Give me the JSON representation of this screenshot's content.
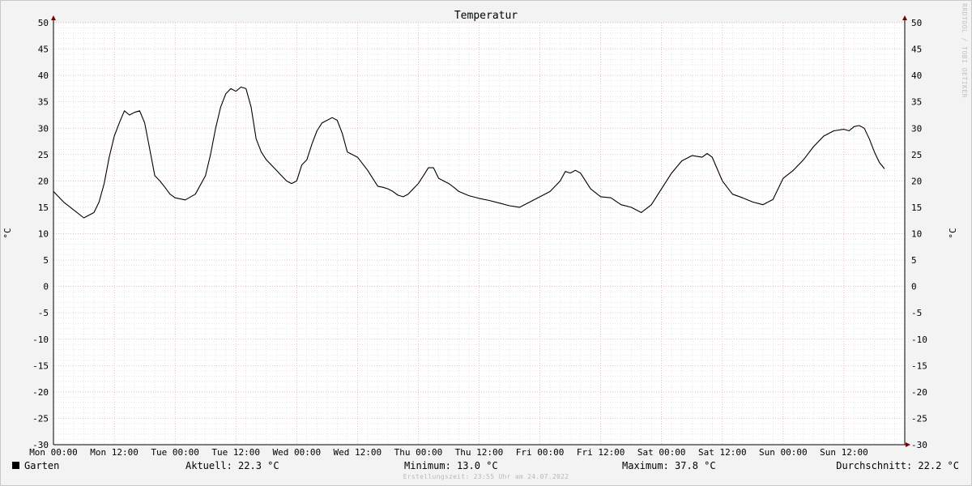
{
  "chart_data": {
    "type": "line",
    "title": "Temperatur",
    "ylabel": "°C",
    "ylim": [
      -30,
      50
    ],
    "ytick_values": [
      50,
      45,
      40,
      35,
      30,
      25,
      20,
      15,
      10,
      5,
      0,
      -5,
      -10,
      -15,
      -20,
      -25,
      -30
    ],
    "y_ticks": [
      "50",
      "45",
      "40",
      "35",
      "30",
      "25",
      "20",
      "15",
      "10",
      "5",
      "0",
      "-5",
      "-10",
      "-15",
      "-20",
      "-25",
      "-30"
    ],
    "x_ticks": [
      "Mon 00:00",
      "Mon 12:00",
      "Tue 00:00",
      "Tue 12:00",
      "Wed 00:00",
      "Wed 12:00",
      "Thu 00:00",
      "Thu 12:00",
      "Fri 00:00",
      "Fri 12:00",
      "Sat 00:00",
      "Sat 12:00",
      "Sun 00:00",
      "Sun 12:00"
    ],
    "xlim_hours": [
      0,
      168
    ],
    "grid": true,
    "series": [
      {
        "name": "Garten",
        "color": "#000000",
        "x_hours": [
          0,
          2,
          4,
          6,
          8,
          9,
          10,
          11,
          12,
          13,
          14,
          15,
          16,
          17,
          18,
          19,
          20,
          21,
          22,
          23,
          24,
          26,
          28,
          30,
          31,
          32,
          33,
          34,
          35,
          36,
          37,
          38,
          39,
          40,
          41,
          42,
          43,
          44,
          45,
          46,
          47,
          48,
          49,
          50,
          51,
          52,
          53,
          54,
          55,
          56,
          57,
          58,
          60,
          62,
          64,
          65,
          66,
          67,
          68,
          69,
          70,
          71,
          72,
          73,
          74,
          75,
          76,
          77,
          78,
          79,
          80,
          82,
          84,
          86,
          88,
          90,
          92,
          94,
          96,
          98,
          100,
          101,
          102,
          103,
          104,
          105,
          106,
          108,
          110,
          112,
          114,
          116,
          118,
          120,
          122,
          124,
          126,
          128,
          129,
          130,
          132,
          134,
          136,
          138,
          140,
          142,
          143,
          144,
          146,
          148,
          150,
          152,
          154,
          156,
          157,
          158,
          159,
          160,
          161,
          162,
          163,
          164,
          165,
          166,
          167,
          168
        ],
        "values": [
          18.0,
          16.0,
          14.5,
          13.0,
          14.0,
          16.0,
          19.5,
          24.5,
          28.5,
          31.0,
          33.3,
          32.5,
          33.0,
          33.3,
          31.0,
          26.0,
          21.0,
          20.0,
          18.8,
          17.5,
          16.8,
          16.4,
          17.5,
          21.0,
          25.0,
          30.0,
          34.0,
          36.5,
          37.5,
          37.0,
          37.8,
          37.5,
          34.0,
          28.0,
          25.5,
          24.0,
          23.0,
          22.0,
          21.0,
          20.0,
          19.5,
          20.0,
          23.0,
          24.0,
          27.0,
          29.5,
          31.0,
          31.5,
          32.0,
          31.5,
          29.0,
          25.5,
          24.5,
          22.0,
          19.0,
          18.8,
          18.5,
          18.0,
          17.3,
          17.0,
          17.5,
          18.5,
          19.5,
          21.0,
          22.5,
          22.5,
          20.5,
          20.0,
          19.5,
          18.8,
          18.0,
          17.2,
          16.7,
          16.3,
          15.8,
          15.3,
          15.0,
          16.0,
          17.0,
          18.0,
          20.0,
          21.8,
          21.5,
          22.0,
          21.5,
          20.0,
          18.5,
          17.0,
          16.8,
          15.5,
          15.0,
          14.0,
          15.5,
          18.5,
          21.5,
          23.8,
          24.8,
          24.5,
          25.2,
          24.5,
          20.0,
          17.5,
          16.8,
          16.0,
          15.5,
          16.5,
          18.5,
          20.5,
          22.0,
          24.0,
          26.5,
          28.5,
          29.5,
          29.8,
          29.5,
          30.3,
          30.5,
          30.0,
          28.0,
          25.5,
          23.5,
          22.3
        ]
      }
    ]
  },
  "legend": {
    "series_name": "Garten",
    "current": "Aktuell: 22.3 °C",
    "minimum": "Minimum: 13.0 °C",
    "maximum": "Maximum: 37.8 °C",
    "average": "Durchschnitt: 22.2 °C"
  },
  "footer": "Erstellungszeit: 23:55 Uhr am 24.07.2022",
  "watermark": "RRDTOOL / TOBI OETIKER",
  "colors": {
    "grid_major": "#e6a0a0",
    "grid_minor": "#d8d8d8",
    "plot_bg": "#ffffff",
    "axis": "#000000",
    "arrow": "#800000"
  }
}
